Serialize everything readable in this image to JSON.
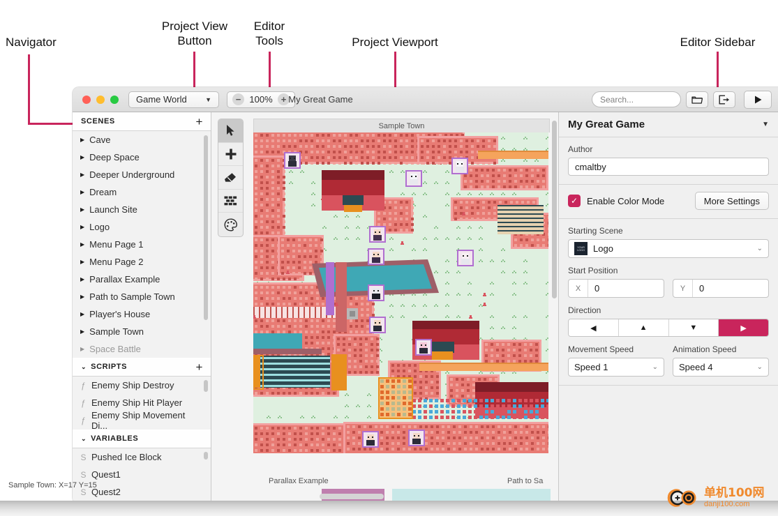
{
  "annotations": [
    {
      "id": "navigator",
      "label": "Navigator"
    },
    {
      "id": "project-view-button",
      "label": "Project View\nButton"
    },
    {
      "id": "editor-tools",
      "label": "Editor\nTools"
    },
    {
      "id": "project-viewport",
      "label": "Project Viewport"
    },
    {
      "id": "editor-sidebar",
      "label": "Editor Sidebar"
    }
  ],
  "titlebar": {
    "view_button_label": "Game World",
    "view_button_caret": "▼",
    "zoom_out": "−",
    "zoom_value": "100%",
    "zoom_in": "+",
    "project_title": "My Great Game",
    "search_placeholder": "Search...",
    "open_icon": "folder-icon",
    "export_icon": "export-icon",
    "play_icon": "play-icon"
  },
  "navigator": {
    "sections": [
      {
        "title": "SCENES",
        "collapsed": false,
        "chevron": "▶",
        "add": "+",
        "items": [
          {
            "label": "Cave"
          },
          {
            "label": "Deep Space"
          },
          {
            "label": "Deeper Underground"
          },
          {
            "label": "Dream"
          },
          {
            "label": "Launch Site"
          },
          {
            "label": "Logo"
          },
          {
            "label": "Menu Page 1"
          },
          {
            "label": "Menu Page 2"
          },
          {
            "label": "Parallax Example"
          },
          {
            "label": "Path to Sample Town"
          },
          {
            "label": "Player's House"
          },
          {
            "label": "Sample Town"
          },
          {
            "label": "Space Battle"
          }
        ]
      },
      {
        "title": "SCRIPTS",
        "collapsed": false,
        "chevron": "⌄",
        "add": "+",
        "items": [
          {
            "label": "Enemy Ship Destroy"
          },
          {
            "label": "Enemy Ship Hit Player"
          },
          {
            "label": "Enemy Ship Movement Di..."
          }
        ]
      },
      {
        "title": "VARIABLES",
        "collapsed": false,
        "chevron": "⌄",
        "add": "",
        "items": [
          {
            "label": "Pushed Ice Block"
          },
          {
            "label": "Quest1"
          },
          {
            "label": "Quest2"
          }
        ]
      }
    ]
  },
  "tools": [
    {
      "name": "select-tool",
      "glyph": "cursor",
      "active": true
    },
    {
      "name": "add-tool",
      "glyph": "plus",
      "active": false
    },
    {
      "name": "eraser-tool",
      "glyph": "eraser",
      "active": false
    },
    {
      "name": "tile-tool",
      "glyph": "bricks",
      "active": false
    },
    {
      "name": "paint-tool",
      "glyph": "palette",
      "active": false
    }
  ],
  "viewport": {
    "scene_label": "Sample Town",
    "status": "Sample Town: X=17 Y=15",
    "thumbnails": [
      {
        "label": "Parallax Example",
        "color": "#bf7fae"
      },
      {
        "label": "Path to Sa",
        "color": "#c8e8e8"
      }
    ]
  },
  "sidebar": {
    "title": "My Great Game",
    "caret": "▼",
    "author_label": "Author",
    "author_value": "cmaltby",
    "color_mode_label": "Enable Color Mode",
    "color_mode_checked": true,
    "more_settings_label": "More Settings",
    "starting_scene_label": "Starting Scene",
    "starting_scene_value": "Logo",
    "starting_scene_thumb": "YOUR LOGO",
    "start_position_label": "Start Position",
    "x_key": "X",
    "x_value": "0",
    "y_key": "Y",
    "y_value": "0",
    "direction_label": "Direction",
    "directions": [
      {
        "name": "left",
        "glyph": "◀",
        "active": false
      },
      {
        "name": "up",
        "glyph": "▲",
        "active": false
      },
      {
        "name": "down",
        "glyph": "▼",
        "active": false
      },
      {
        "name": "right",
        "glyph": "▶",
        "active": true
      }
    ],
    "movement_speed_label": "Movement Speed",
    "movement_speed_value": "Speed 1",
    "animation_speed_label": "Animation Speed",
    "animation_speed_value": "Speed 4"
  },
  "watermark": {
    "cn": "单机100网",
    "en": "danji100.com"
  },
  "colors": {
    "accent": "#C9255C",
    "checkbox": "#C9255C",
    "window_chrome": "#ececec",
    "watermark": "#F08A2E"
  }
}
